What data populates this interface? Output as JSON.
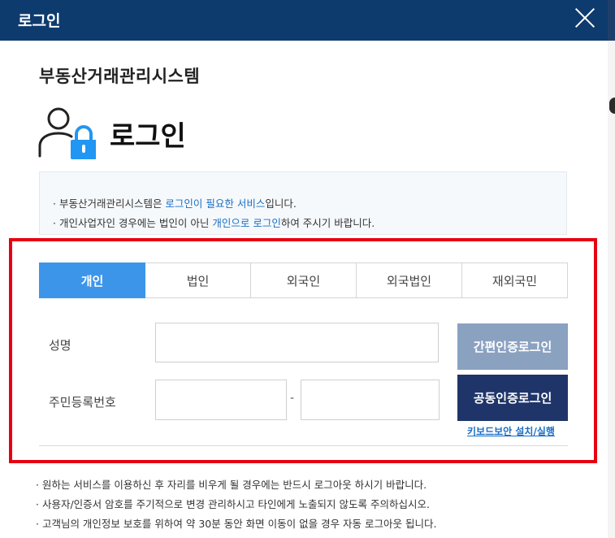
{
  "window": {
    "title": "로그인"
  },
  "system_name": "부동산거래관리시스템",
  "heading": "로그인",
  "notice": {
    "line1": {
      "prefix": "· 부동산거래관리시스템은 ",
      "highlight": "로그인이 필요한 서비스",
      "suffix": "입니다."
    },
    "line2": {
      "prefix": "· 개인사업자인 경우에는 법인이 아닌 ",
      "highlight": "개인으로 로그인",
      "suffix": "하여 주시기 바랍니다."
    }
  },
  "tabs": [
    {
      "label": "개인",
      "active": true
    },
    {
      "label": "법인",
      "active": false
    },
    {
      "label": "외국인",
      "active": false
    },
    {
      "label": "외국법인",
      "active": false
    },
    {
      "label": "재외국민",
      "active": false
    }
  ],
  "form": {
    "name_label": "성명",
    "name_value": "",
    "rrn_label": "주민등록번호",
    "rrn_front_value": "",
    "rrn_separator": "-",
    "rrn_back_value": ""
  },
  "buttons": {
    "simple_cert": "간편인증로그인",
    "public_cert": "공동인증로그인",
    "keyboard_security": "키보드보안 설치/실행"
  },
  "bottom_notices": [
    "· 원하는 서비스를 이용하신 후 자리를 비우게 될 경우에는 반드시 로그아웃 하시기 바랍니다.",
    "· 사용자/인증서 암호를 주기적으로 변경 관리하시고 타인에게 노출되지 않도록 주의하십시오.",
    "· 고객님의 개인정보 보호를 위하여 약 30분 동안 화면 이동이 없을 경우 자동 로그아웃 됩니다."
  ],
  "colors": {
    "header_bg": "#0e3b6e",
    "tab_active": "#3d95ea",
    "simple_cert_btn": "#8aa1c0",
    "public_cert_btn": "#1f3569",
    "highlight_frame": "#e60012",
    "link": "#1a6fc4",
    "lock_icon": "#2196f3"
  },
  "icons": {
    "login": "user-lock-icon",
    "close": "close-icon"
  }
}
